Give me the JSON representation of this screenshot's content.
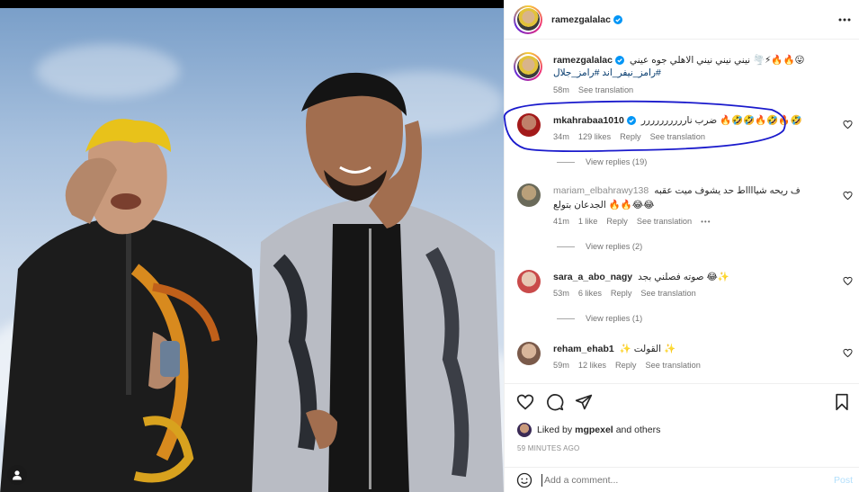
{
  "post": {
    "author": "ramezgalalac",
    "caption_line1": "😛🔥🔥⚡🌪️ نيني نيني نيني الاهلي جوه عيني",
    "caption_line2": "#رامز_نيفر_اند #رامز_جلال",
    "caption_time": "58m",
    "see_translation": "See translation",
    "liked_by_prefix": "Liked by ",
    "liked_by_user": "mgpexel",
    "liked_by_suffix": " and others",
    "timestamp": "59 MINUTES AGO"
  },
  "comments": [
    {
      "username": "mkahrabaa1010",
      "verified": true,
      "text": "🤣🔥🤣🔥🤣🤣🔥 ضرب نارررررررررر",
      "time": "34m",
      "likes": "129 likes",
      "reply": "Reply",
      "see_translation": "See translation",
      "view_replies": "View replies (19)"
    },
    {
      "username": "mariam_elbahrawy138",
      "text_line1": "ف ريحه شيااااط حد يشوف ميت عقبه",
      "text_line2": "😂😂🔥🔥 الجدعان بتولع",
      "time": "41m",
      "likes": "1 like",
      "reply": "Reply",
      "see_translation": "See translation",
      "more": "•••",
      "view_replies": "View replies (2)"
    },
    {
      "username": "sara_a_abo_nagy",
      "text": "✨😂 صوته فصلني بجد",
      "time": "53m",
      "likes": "6 likes",
      "reply": "Reply",
      "see_translation": "See translation",
      "view_replies": "View replies (1)"
    },
    {
      "username": "reham_ehab1",
      "text": "✨ القولت ✨",
      "time": "59m",
      "likes": "12 likes",
      "reply": "Reply",
      "see_translation": "See translation"
    }
  ],
  "add_comment": {
    "placeholder": "Add a comment...",
    "post_label": "Post"
  },
  "icons": {
    "more": "more-horizontal-icon",
    "like": "heart-icon",
    "comment": "comment-icon",
    "share": "paper-plane-icon",
    "save": "bookmark-icon",
    "emoji": "smiley-icon",
    "user_tag": "user-icon",
    "verified": "verified-badge-icon"
  },
  "colors": {
    "verified_blue": "#0095f6",
    "annotation_blue": "#1a1acc",
    "post_disabled": "#b2dffc",
    "secondary_text": "#737373"
  }
}
